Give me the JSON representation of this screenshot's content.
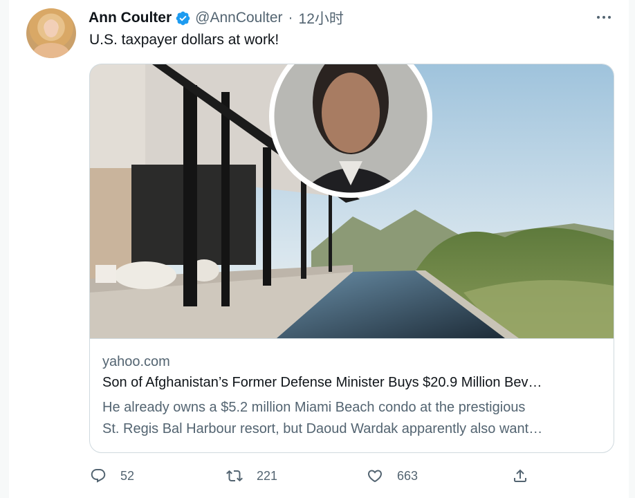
{
  "tweet": {
    "author_name": "Ann Coulter",
    "handle": "@AnnCoulter",
    "separator": "·",
    "time": "12小时",
    "text": "U.S. taxpayer dollars at work!"
  },
  "card": {
    "domain": "yahoo.com",
    "title": "Son of Afghanistan’s Former Defense Minister Buys $20.9 Million Bev…",
    "description_line1": "He already owns a $5.2 million Miami Beach condo at the prestigious",
    "description_line2": "St. Regis Bal Harbour resort, but Daoud Wardak apparently also want…"
  },
  "actions": {
    "replies": "52",
    "retweets": "221",
    "likes": "663"
  },
  "colors": {
    "verified_blue": "#1d9bf0",
    "secondary_text": "#536471",
    "primary_text": "#0f1419",
    "border": "#cfd9de"
  },
  "icons": [
    "verified-badge-icon",
    "more-icon",
    "reply-icon",
    "retweet-icon",
    "like-icon",
    "share-icon"
  ]
}
